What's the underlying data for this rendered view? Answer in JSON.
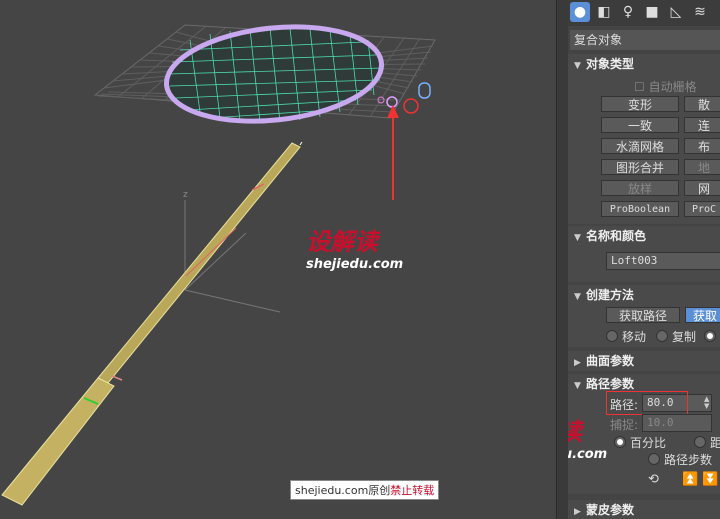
{
  "toolbar": {
    "tabs": [
      "create",
      "modify",
      "hierarchy",
      "motion",
      "display",
      "utilities"
    ]
  },
  "category": "复合对象",
  "object_type": {
    "title": "对象类型",
    "autogrid": "自动栅格",
    "buttons": [
      "变形",
      "散",
      "一致",
      "连",
      "水滴网格",
      "布",
      "图形合并",
      "地",
      "放样",
      "网",
      "ProBoolean",
      "ProC"
    ]
  },
  "name_color": {
    "title": "名称和颜色",
    "name": "Loft003"
  },
  "create_method": {
    "title": "创建方法",
    "get_path": "获取路径",
    "get_shape": "获取",
    "move": "移动",
    "copy": "复制"
  },
  "surface_params": {
    "title": "曲面参数"
  },
  "path_params": {
    "title": "路径参数",
    "path_label": "路径:",
    "path_value": "80.0",
    "snap_label": "捕捉:",
    "snap_value": "10.0",
    "percent": "百分比",
    "distance": "距",
    "path_steps": "路径步数"
  },
  "skin_params": {
    "title": "蒙皮参数"
  },
  "watermark": {
    "cn": "设解读",
    "en": "shejiedu.com"
  },
  "caption": {
    "text": "shejiedu.com原创",
    "warning": "禁止转载"
  },
  "colors": {
    "accent": "#5b8fd8",
    "highlight": "#e33333",
    "brand": "#c8102e",
    "racket_rim": "#c8a8ee",
    "racket_string": "#4ddbb0",
    "handle": "#d8c868"
  }
}
